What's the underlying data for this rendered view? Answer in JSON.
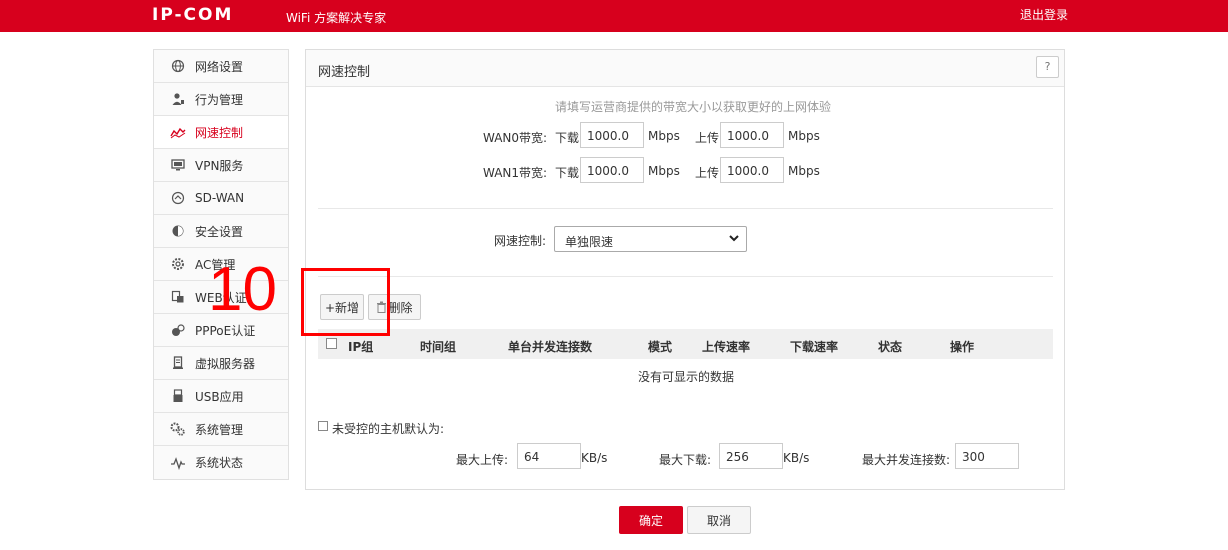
{
  "header": {
    "logo": "IP-COM",
    "slogan": "WiFi 方案解决专家",
    "logout": "退出登录",
    "brand_color": "#d7001d"
  },
  "sidebar": {
    "items": [
      {
        "label": "网络设置",
        "icon": "globe-icon",
        "active": false
      },
      {
        "label": "行为管理",
        "icon": "user-manage-icon",
        "active": false
      },
      {
        "label": "网速控制",
        "icon": "speed-wave-icon",
        "active": true
      },
      {
        "label": "VPN服务",
        "icon": "monitor-icon",
        "active": false
      },
      {
        "label": "SD-WAN",
        "icon": "sdwan-icon",
        "active": false
      },
      {
        "label": "安全设置",
        "icon": "shield-icon",
        "active": false
      },
      {
        "label": "AC管理",
        "icon": "ac-gear-icon",
        "active": false
      },
      {
        "label": "WEB认证",
        "icon": "web-auth-icon",
        "active": false
      },
      {
        "label": "PPPoE认证",
        "icon": "pppoe-icon",
        "active": false
      },
      {
        "label": "虚拟服务器",
        "icon": "server-icon",
        "active": false
      },
      {
        "label": "USB应用",
        "icon": "usb-icon",
        "active": false
      },
      {
        "label": "系统管理",
        "icon": "gears-icon",
        "active": false
      },
      {
        "label": "系统状态",
        "icon": "pulse-icon",
        "active": false
      }
    ]
  },
  "panel": {
    "title": "网速控制",
    "help": "?",
    "hint": "请填写运营商提供的带宽大小以获取更好的上网体验",
    "wan0": {
      "label": "WAN0带宽:",
      "down_label": "下载",
      "down_value": "1000.0",
      "up_label": "上传",
      "up_value": "1000.0",
      "unit": "Mbps"
    },
    "wan1": {
      "label": "WAN1带宽:",
      "down_label": "下载",
      "down_value": "1000.0",
      "up_label": "上传",
      "up_value": "1000.0",
      "unit": "Mbps"
    },
    "speed_control": {
      "label": "网速控制:",
      "selected": "单独限速"
    },
    "add_button": "+新增",
    "delete_button": "删除",
    "table": {
      "columns": [
        "IP组",
        "时间组",
        "单台并发连接数",
        "模式",
        "上传速率",
        "下载速率",
        "状态",
        "操作"
      ],
      "empty": "没有可显示的数据"
    },
    "defaults": {
      "label": "未受控的主机默认为:",
      "max_up_label": "最大上传:",
      "max_up_value": "64",
      "max_up_unit": "KB/s",
      "max_down_label": "最大下载:",
      "max_down_value": "256",
      "max_down_unit": "KB/s",
      "max_conn_label": "最大并发连接数:",
      "max_conn_value": "300"
    }
  },
  "footer": {
    "ok": "确定",
    "cancel": "取消"
  },
  "annotation": {
    "number": "10",
    "color": "#ff0000"
  }
}
